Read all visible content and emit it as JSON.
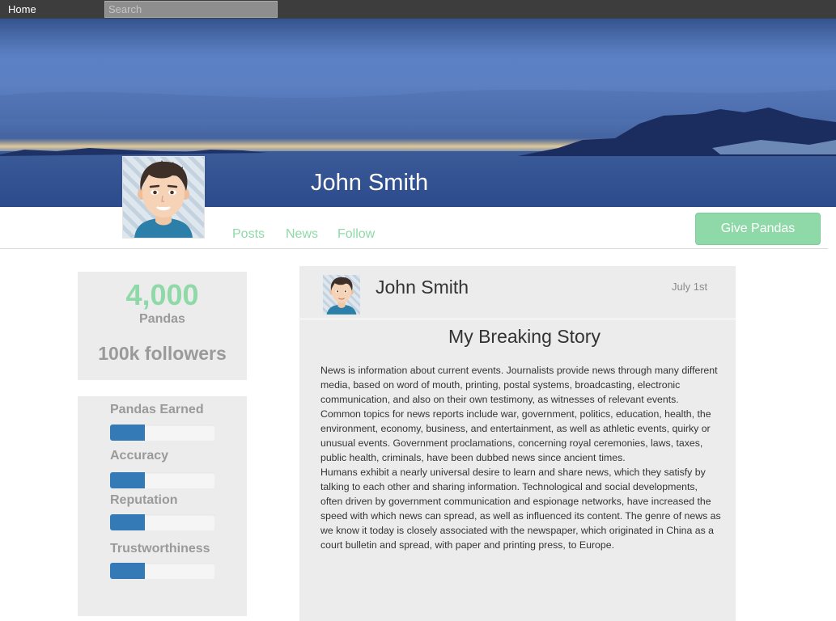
{
  "topbar": {
    "home_label": "Home",
    "search_placeholder": "Search"
  },
  "profile": {
    "name": "John Smith",
    "tabs": [
      {
        "label": "Posts"
      },
      {
        "label": "News"
      },
      {
        "label": "Follow"
      }
    ],
    "give_button_label": "Give Pandas"
  },
  "stats": {
    "pandas_count": "4,000",
    "pandas_label": "Pandas",
    "followers_label": "100k followers"
  },
  "metrics": [
    {
      "label": "Pandas Earned",
      "fraction": 0.33
    },
    {
      "label": "Accuracy",
      "fraction": 0.33
    },
    {
      "label": "Reputation",
      "fraction": 0.33
    },
    {
      "label": "Trustworthiness",
      "fraction": 0.33
    }
  ],
  "post": {
    "author": "John Smith",
    "date": "July 1st",
    "title": "My Breaking Story",
    "paragraphs": [
      "News is information about current events. Journalists provide news through many different media, based on word of mouth, printing, postal systems, broadcasting, electronic communication, and also on their own testimony, as witnesses of relevant events.",
      "Common topics for news reports include war, government, politics, education, health, the environment, economy, business, and entertainment, as well as athletic events, quirky or unusual events. Government proclamations, concerning royal ceremonies, laws, taxes, public health, criminals, have been dubbed news since ancient times.",
      "Humans exhibit a nearly universal desire to learn and share news, which they satisfy by talking to each other and sharing information. Technological and social developments, often driven by government communication and espionage networks, have increased the speed with which news can spread, as well as influenced its content. The genre of news as we know it today is closely associated with the newspaper, which originated in China as a court bulletin and spread, with paper and printing press, to Europe."
    ]
  },
  "colors": {
    "accent_green": "#8fd9a8",
    "bar_blue": "#337ab7",
    "topbar": "#3d3d3d",
    "panel_gray": "#ececec"
  },
  "icons": {
    "avatar": "cartoon-man-avatar-icon"
  }
}
